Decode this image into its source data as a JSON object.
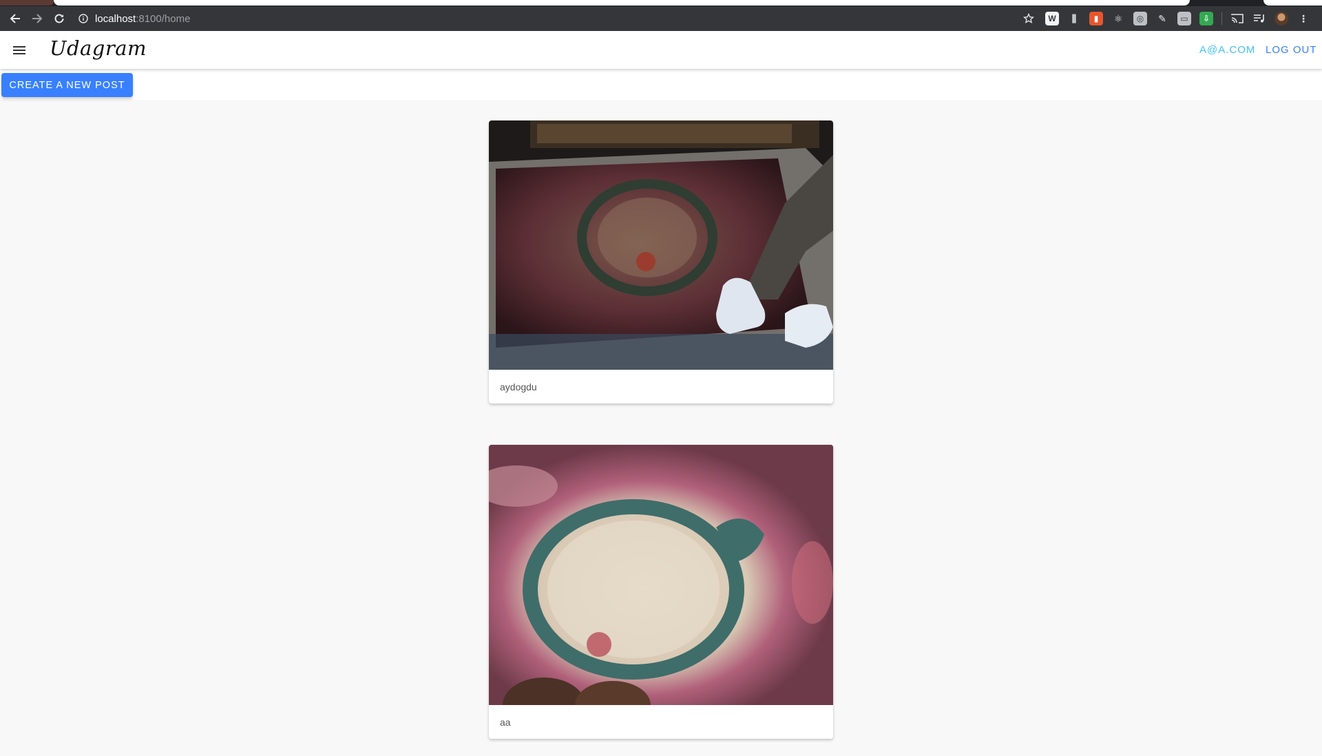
{
  "browser": {
    "url_host": "localhost",
    "url_path": ":8100/home",
    "icons": [
      "back-arrow-icon",
      "forward-arrow-icon",
      "reload-icon",
      "info-icon",
      "star-icon",
      "cast-icon",
      "media-queue-icon",
      "avatar",
      "kebab-menu-icon"
    ],
    "extensions": [
      {
        "name": "w-extension-icon",
        "glyph": "W"
      },
      {
        "name": "sliders-extension-icon",
        "glyph": "⫼"
      },
      {
        "name": "orange-extension-icon",
        "glyph": "■"
      },
      {
        "name": "react-extension-icon",
        "glyph": "⚛"
      },
      {
        "name": "camera-extension-icon",
        "glyph": "◎"
      },
      {
        "name": "pen-extension-icon",
        "glyph": "✎"
      },
      {
        "name": "gray-extension-icon",
        "glyph": "▭"
      },
      {
        "name": "download-extension-icon",
        "glyph": "⇩"
      }
    ]
  },
  "header": {
    "brand": "Udagram",
    "user_email": "A@A.COM",
    "logout_label": "LOG OUT"
  },
  "actions": {
    "create_post_label": "CREATE A NEW POST"
  },
  "feed": {
    "items": [
      {
        "caption": "aydogdu",
        "image": "tapestry-with-gloved-hands"
      },
      {
        "caption": "aa",
        "image": "tapestry-dragon-circle"
      }
    ]
  },
  "colors": {
    "primary": "#3880ff",
    "secondary": "#3dc2ff",
    "toolbar": "#35363a",
    "page_bg": "#f8f8f8"
  }
}
